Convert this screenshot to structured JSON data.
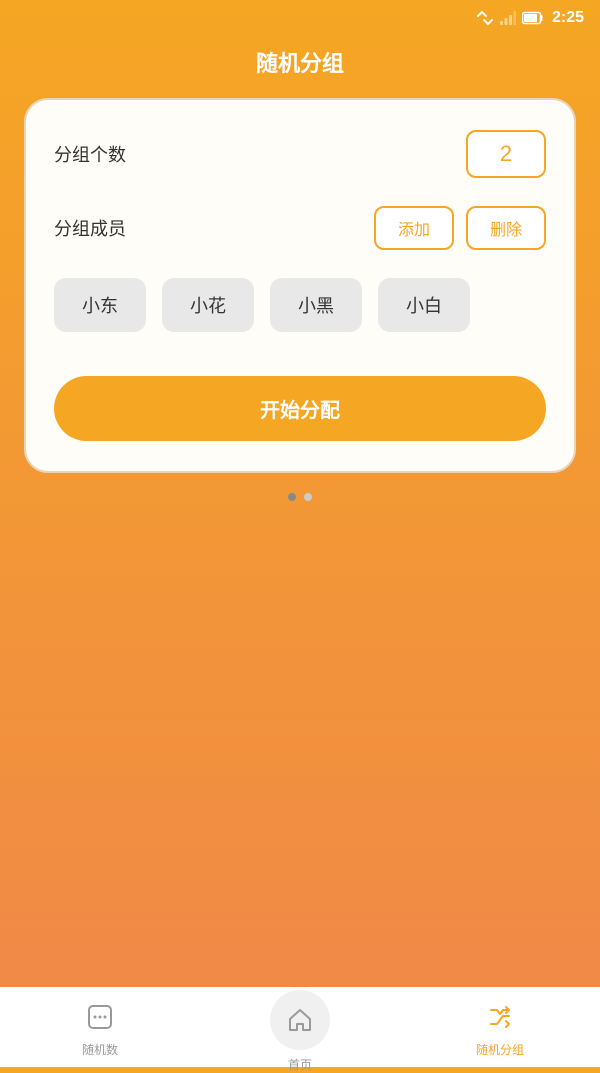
{
  "statusBar": {
    "time": "2:25",
    "icons": [
      "arrows-icon",
      "signal-icon",
      "battery-icon"
    ]
  },
  "header": {
    "title": "随机分组"
  },
  "form": {
    "groupCountLabel": "分组个数",
    "groupCountValue": "2",
    "membersLabel": "分组成员",
    "addButton": "添加",
    "deleteButton": "删除"
  },
  "members": [
    {
      "name": "小东"
    },
    {
      "name": "小花"
    },
    {
      "name": "小黑"
    },
    {
      "name": "小白"
    }
  ],
  "startButton": "开始分配",
  "bottomNav": {
    "items": [
      {
        "id": "random-num",
        "label": "随机数",
        "active": false
      },
      {
        "id": "home",
        "label": "首页",
        "active": false
      },
      {
        "id": "random-group",
        "label": "随机分组",
        "active": true
      }
    ]
  }
}
